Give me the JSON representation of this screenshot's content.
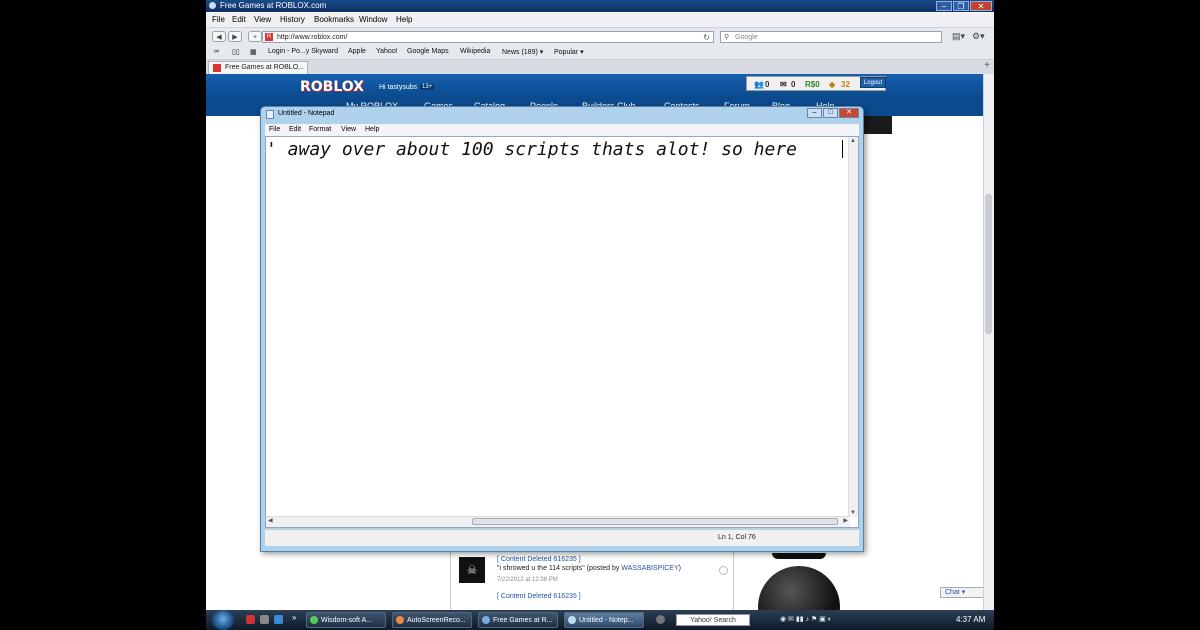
{
  "browser": {
    "window_title": "Free Games at ROBLOX.com",
    "menu": [
      "File",
      "Edit",
      "View",
      "History",
      "Bookmarks",
      "Window",
      "Help"
    ],
    "url": "http://www.roblox.com/",
    "search_placeholder": "Google",
    "bookmarks": [
      "Login - Po...y Skyward",
      "Apple",
      "Yahoo!",
      "Google Maps",
      "Wikipedia",
      "News (189) ▾",
      "Popular ▾"
    ],
    "tab_label": "Free Games at ROBLO..."
  },
  "roblox": {
    "logo": "ROBLOX",
    "greeting": "Hi tastysubs",
    "age_badge": "13+",
    "stats": {
      "friends": "0",
      "messages": "0",
      "robux": "R$0",
      "tickets": "32"
    },
    "logout_label": "Logout",
    "nav": [
      "My ROBLOX",
      "Games",
      "Catalog",
      "People",
      "Builders Club",
      "Contests",
      "Forum",
      "Blog",
      "Help"
    ],
    "comments": {
      "deleted_1": "[ Content Deleted 616235 ]",
      "comment_text": "\"i shrowed u the 114 scripts\" (posted by ",
      "comment_user": "WASSABISPICEY",
      "comment_close": ")",
      "date": "7/22/2012 at 12:38 PM",
      "deleted_2": "[ Content Deleted 616235 ]"
    },
    "chat_label": "Chat ▾"
  },
  "notepad": {
    "title": "Untitled - Notepad",
    "menu": [
      "File",
      "Edit",
      "Format",
      "View",
      "Help"
    ],
    "content": "' away over about 100 scripts thats alot! so here",
    "status": "Ln 1, Col 76"
  },
  "taskbar": {
    "items": [
      "Wisdom-soft A...",
      "AutoScreenReco...",
      "Free Games at R...",
      "Untitled - Notep..."
    ],
    "search_label": "Yahoo! Search",
    "clock": "4:37 AM"
  },
  "colors": {
    "roblox_blue": "#0b4a8d",
    "notepad_frame": "#aed1ec",
    "taskbar": "#1a2a3c"
  }
}
